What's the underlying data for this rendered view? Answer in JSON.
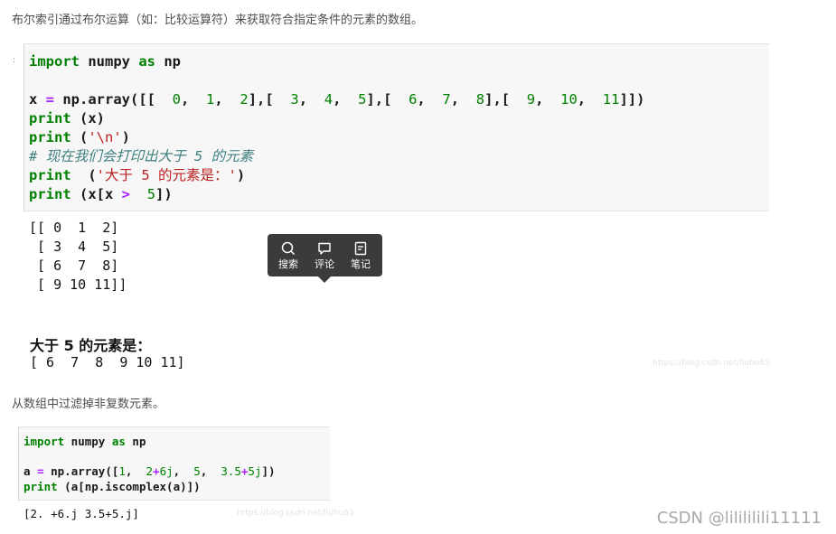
{
  "intro_text": "布尔索引通过布尔运算（如：比较运算符）来获取符合指定条件的元素的数组。",
  "block1": {
    "marker": ":",
    "code": {
      "l1_kw": "import",
      "l1_mod": " numpy ",
      "l1_as": "as",
      "l1_alias": " np",
      "l3_var": "x ",
      "l3_eq": "=",
      "l3_call": " np.array([[  ",
      "n0": "0",
      "c0": ",  ",
      "n1": "1",
      "c1": ",  ",
      "n2": "2",
      "b1": "],[  ",
      "n3": "3",
      "c3": ",  ",
      "n4": "4",
      "c4": ",  ",
      "n5": "5",
      "b2": "],[  ",
      "n6": "6",
      "c6": ",  ",
      "n7": "7",
      "c7": ",  ",
      "n8": "8",
      "b3": "],[  ",
      "n9": "9",
      "c9": ",  ",
      "n10": "10",
      "c10": ",  ",
      "n11": "11",
      "b4": "]])",
      "l4_kw": "print",
      "l4_rest": " (x)",
      "l5_kw": "print",
      "l5_open": " (",
      "l5_str": "'\\n'",
      "l5_close": ")",
      "l6_comment": "# 现在我们会打印出大于 5 的元素",
      "l7_kw": "print",
      "l7_open": "  (",
      "l7_str": "'大于 5 的元素是：'",
      "l7_close": ")",
      "l8_kw": "print",
      "l8_a": " (x[x ",
      "l8_op": ">",
      "l8_b": "  ",
      "l8_num": "5",
      "l8_c": "])"
    },
    "output_array": "[[ 0  1  2]\n [ 3  4  5]\n [ 6  7  8]\n [ 9 10 11]]",
    "output_label": "大于 5 的元素是：",
    "output_result": "[ 6  7  8  9 10 11]",
    "watermark": "https://blog.csdn.net/liuhu63"
  },
  "popup": {
    "search": "搜索",
    "comment": "评论",
    "note": "笔记"
  },
  "para2": "从数组中过滤掉非复数元素。",
  "block2": {
    "code": {
      "l1_kw": "import",
      "l1_mod": " numpy ",
      "l1_as": "as",
      "l1_alias": " np",
      "l3_var": "a ",
      "l3_eq": "=",
      "l3_call": " np.array([",
      "v1": "1",
      "s1": ",  ",
      "v2": "2",
      "p2": "+",
      "v2b": "6j",
      "s2": ",  ",
      "v3": "5",
      "s3": ",  ",
      "v4": "3.5",
      "p4": "+",
      "v4b": "5j",
      "e": "])",
      "l4_kw": "print",
      "l4_rest": " (a[np.iscomplex(a)])"
    },
    "output": "[2. +6.j 3.5+5.j]",
    "watermark": "https://blog.csdn.net/liuhu63"
  },
  "footer_brand": "CSDN @lilililili11111"
}
